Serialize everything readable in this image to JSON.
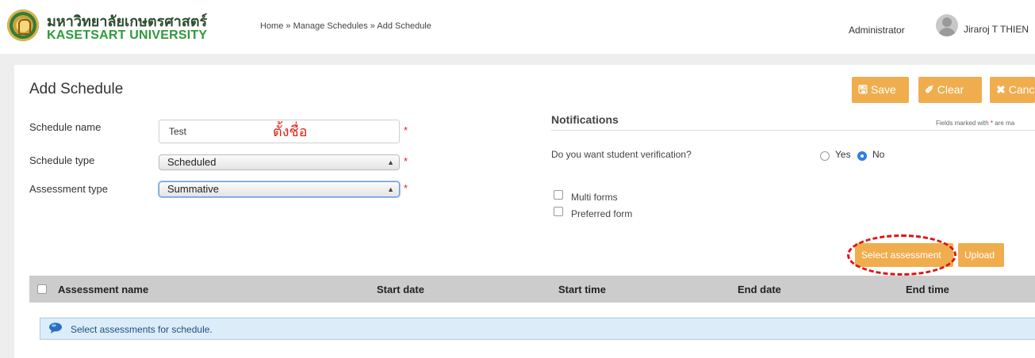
{
  "header": {
    "university_th": "มหาวิทยาลัยเกษตรศาสตร์",
    "university_en": "KASETSART UNIVERSITY",
    "breadcrumb": "Home » Manage Schedules » Add Schedule",
    "role": "Administrator",
    "user_name": "Jiraroj T THIEN"
  },
  "page": {
    "title": "Add Schedule"
  },
  "actions": {
    "save": "Save",
    "clear": "Clear",
    "cancel": "Cancel"
  },
  "form": {
    "schedule_name_label": "Schedule name",
    "schedule_name_value": "Test",
    "schedule_name_note": "ตั้งชื่อ",
    "schedule_type_label": "Schedule type",
    "schedule_type_value": "Scheduled",
    "assessment_type_label": "Assessment type",
    "assessment_type_value": "Summative",
    "required_mark": "*"
  },
  "notifications": {
    "title": "Notifications",
    "fields_note_prefix": "Fields marked with",
    "fields_note_star": "*",
    "fields_note_suffix": "are ma",
    "question": "Do you want student verification?",
    "yes_label": "Yes",
    "no_label": "No",
    "selected": "No",
    "multi_forms": "Multi forms",
    "preferred_form": "Preferred form"
  },
  "assessment_actions": {
    "select_assessment": "Select assessment",
    "upload": "Upload"
  },
  "table": {
    "columns": [
      "Assessment name",
      "Start date",
      "Start time",
      "End date",
      "End time"
    ]
  },
  "info": {
    "message": "Select assessments for schedule."
  },
  "colors": {
    "accent": "#f0ad4e",
    "annotation": "#e0130f",
    "radio_on": "#2f7fe0"
  }
}
